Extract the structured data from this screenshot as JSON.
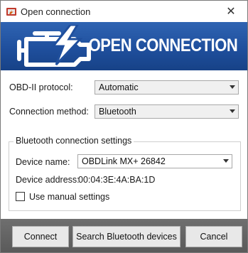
{
  "window": {
    "title": "Open connection",
    "close_glyph": "✕"
  },
  "banner": {
    "title": "OPEN CONNECTION",
    "logo_icon": "check-engine-lightning-icon"
  },
  "form": {
    "protocol_label": "OBD-II protocol:",
    "protocol_value": "Automatic",
    "method_label": "Connection method:",
    "method_value": "Bluetooth"
  },
  "bluetooth": {
    "group_title": "Bluetooth connection settings",
    "device_name_label": "Device name:",
    "device_name_value": "OBDLink MX+ 26842",
    "device_address_label": "Device address:",
    "device_address_value": "00:04:3E:4A:BA:1D",
    "manual_settings_label": "Use manual settings",
    "manual_settings_checked": false
  },
  "buttons": {
    "connect": "Connect",
    "search": "Search Bluetooth devices",
    "cancel": "Cancel"
  },
  "colors": {
    "banner": "#1f4f9d",
    "footer": "#5f5f5f"
  }
}
